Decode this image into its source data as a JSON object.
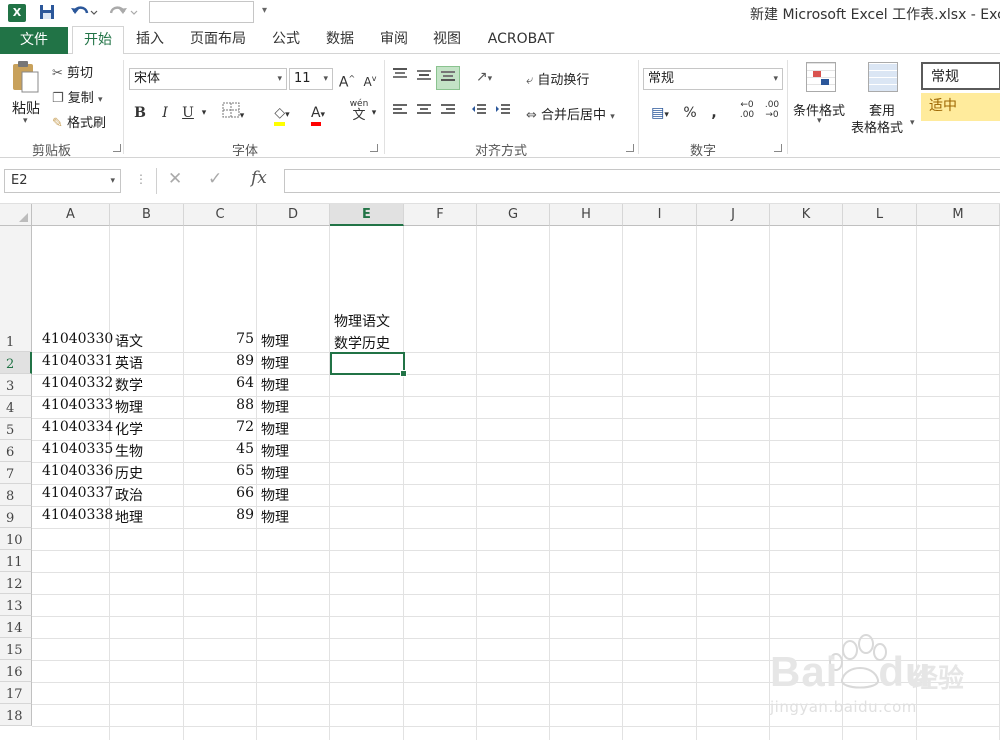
{
  "titlebar": {
    "app_icon": "X",
    "title": "新建 Microsoft Excel 工作表.xlsx - Exce"
  },
  "tabs": [
    {
      "label": "文件"
    },
    {
      "label": "开始"
    },
    {
      "label": "插入"
    },
    {
      "label": "页面布局"
    },
    {
      "label": "公式"
    },
    {
      "label": "数据"
    },
    {
      "label": "审阅"
    },
    {
      "label": "视图"
    },
    {
      "label": "ACROBAT"
    }
  ],
  "ribbon": {
    "clipboard": {
      "paste": "粘贴",
      "cut": "剪切",
      "copy": "复制",
      "format_painter": "格式刷",
      "label": "剪贴板"
    },
    "font": {
      "name": "宋体",
      "size": "11",
      "grow": "A",
      "shrink": "A",
      "bold": "B",
      "italic": "I",
      "underline": "U",
      "font_color_letter": "A",
      "wen": "wén",
      "wen_char": "文",
      "label": "字体"
    },
    "alignment": {
      "wrap": "自动换行",
      "merge": "合并后居中",
      "label": "对齐方式"
    },
    "number": {
      "format": "常规",
      "percent": "%",
      "comma": ",",
      "inc": ".00",
      "dec": ".00",
      "label": "数字"
    },
    "styles": {
      "conditional": "条件格式",
      "table_1": "套用",
      "table_2": "表格格式",
      "normal": "常规",
      "neutral": "适中"
    }
  },
  "formula_bar": {
    "name_box": "E2",
    "fx": "fx",
    "value": ""
  },
  "sheet": {
    "columns": [
      "A",
      "B",
      "C",
      "D",
      "E",
      "F",
      "G",
      "H",
      "I",
      "J",
      "K",
      "L",
      "M"
    ],
    "rows": [
      "1",
      "2",
      "3",
      "4",
      "5",
      "6",
      "7",
      "8",
      "9",
      "10",
      "11",
      "12",
      "13",
      "14",
      "15",
      "16",
      "17",
      "18"
    ],
    "data": [
      {
        "a": "41040330",
        "b": "语文",
        "c": "75",
        "d": "物理"
      },
      {
        "a": "41040331",
        "b": "英语",
        "c": "89",
        "d": "物理"
      },
      {
        "a": "41040332",
        "b": "数学",
        "c": "64",
        "d": "物理"
      },
      {
        "a": "41040333",
        "b": "物理",
        "c": "88",
        "d": "物理"
      },
      {
        "a": "41040334",
        "b": "化学",
        "c": "72",
        "d": "物理"
      },
      {
        "a": "41040335",
        "b": "生物",
        "c": "45",
        "d": "物理"
      },
      {
        "a": "41040336",
        "b": "历史",
        "c": "65",
        "d": "物理"
      },
      {
        "a": "41040337",
        "b": "政治",
        "c": "66",
        "d": "物理"
      },
      {
        "a": "41040338",
        "b": "地理",
        "c": "89",
        "d": "物理"
      }
    ],
    "e1_line1": "物理语文",
    "e1_line2": "数学历史",
    "selected_column": "E",
    "selected_row": "2"
  },
  "watermark": {
    "brand": "Bai",
    "brand2": "du",
    "jingyan": "经验",
    "url": "jingyan.baidu.com"
  },
  "colors": {
    "excel_green": "#217346",
    "neutral_fill": "#ffeb9c"
  }
}
